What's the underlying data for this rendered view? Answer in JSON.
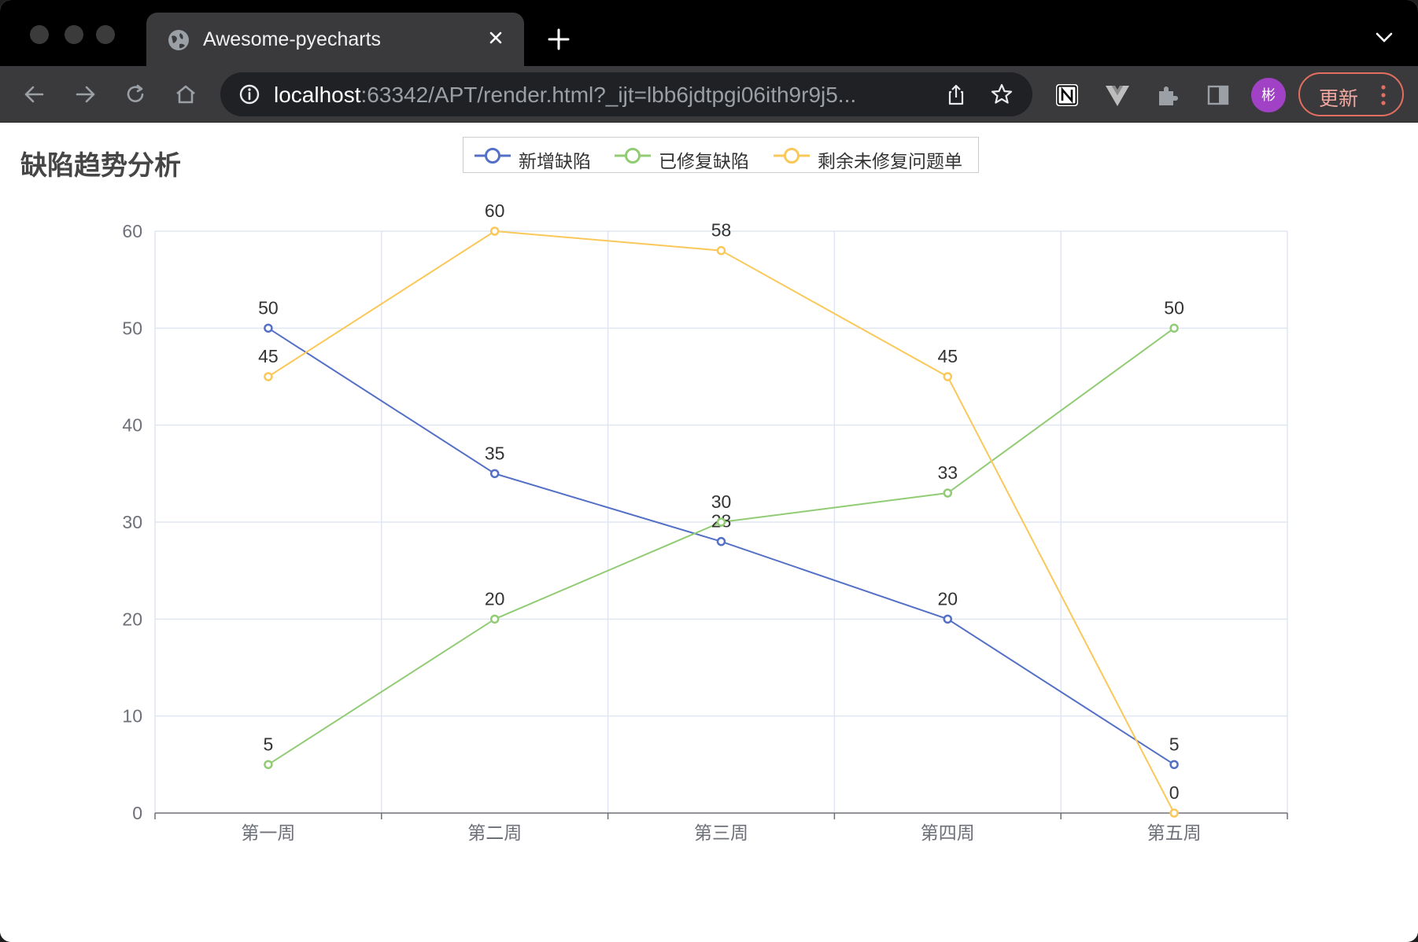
{
  "browser": {
    "tab_title": "Awesome-pyecharts",
    "url_host": "localhost",
    "url_rest": ":63342/APT/render.html?_ijt=lbb6jdtpgi06ith9r9j5...",
    "avatar_text": "彬",
    "update_label": "更新",
    "accent_color": "#e46f61"
  },
  "chart_data": {
    "type": "line",
    "title": "缺陷趋势分析",
    "categories": [
      "第一周",
      "第二周",
      "第三周",
      "第四周",
      "第五周"
    ],
    "ylim": [
      0,
      60
    ],
    "yticks": [
      0,
      10,
      20,
      30,
      40,
      50,
      60
    ],
    "grid": true,
    "legend_position": "top-center",
    "series": [
      {
        "name": "新增缺陷",
        "color": "#5470c6",
        "values": [
          50,
          35,
          28,
          20,
          5
        ]
      },
      {
        "name": "已修复缺陷",
        "color": "#91cc75",
        "values": [
          5,
          20,
          30,
          33,
          50
        ]
      },
      {
        "name": "剩余未修复问题单",
        "color": "#fac858",
        "values": [
          45,
          60,
          58,
          45,
          0
        ]
      }
    ]
  }
}
